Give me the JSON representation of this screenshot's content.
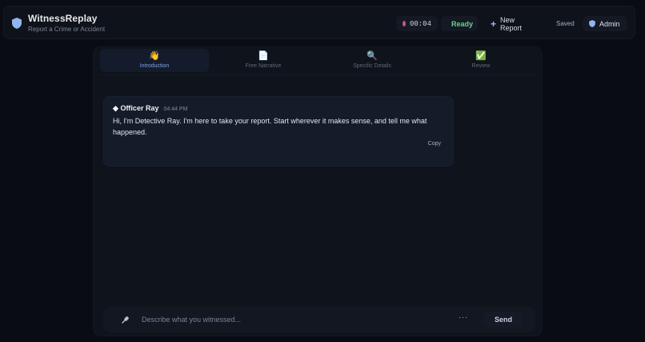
{
  "app": {
    "title": "WitnessReplay",
    "subtitle": "Report a Crime or Accident"
  },
  "header": {
    "timer": "00:04",
    "status": "Ready",
    "new_report_label": "New Report",
    "saved_label": "Saved",
    "admin_label": "Admin"
  },
  "tabs": [
    {
      "label": "Introduction",
      "icon": "👋",
      "icon_name": "waving-hand-icon",
      "active": true
    },
    {
      "label": "Free Narrative",
      "icon": "📄",
      "icon_name": "document-icon",
      "active": false
    },
    {
      "label": "Specific Details",
      "icon": "🔍",
      "icon_name": "magnifier-icon",
      "active": false
    },
    {
      "label": "Review",
      "icon": "✅",
      "icon_name": "check-box-icon",
      "active": false
    }
  ],
  "message": {
    "author_prefix": "◆",
    "author": "Officer Ray",
    "time": "04:44 PM",
    "text": "Hi, I'm Detective Ray. I'm here to take your report. Start wherever it makes sense, and tell me what happened.",
    "copy_label": "Copy"
  },
  "composer": {
    "placeholder": "Describe what you witnessed...",
    "value": "",
    "more_label": "···",
    "send_label": "Send"
  },
  "colors": {
    "background": "#090c12",
    "panel": "#0f131b",
    "accent": "#7ea1e6",
    "ready": "#34c759"
  }
}
